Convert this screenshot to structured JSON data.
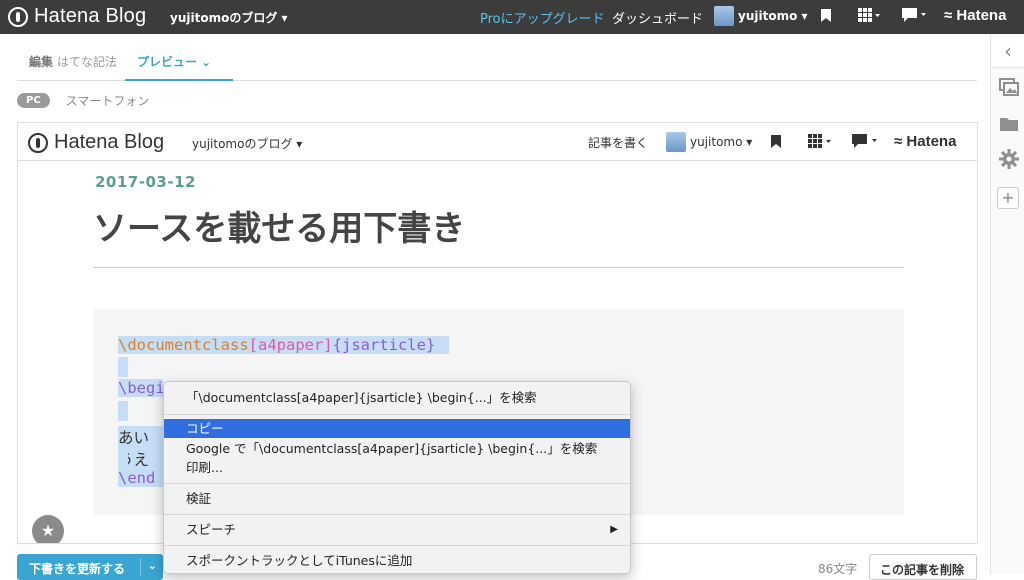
{
  "app": {
    "logo": "Hatena Blog",
    "blog_name": "yujitomoのブログ ▾",
    "pro_upgrade": "Proにアップグレード",
    "dashboard": "ダッシュボード",
    "user": "yujitomo ▾",
    "hatena": "Hatena"
  },
  "tabs": {
    "edit_label": "編集",
    "edit_mode": "はてな記法",
    "preview_label": "プレビュー ⌄"
  },
  "device": {
    "pc": "PC",
    "smartphone": "スマートフォン"
  },
  "preview": {
    "header": {
      "logo": "Hatena Blog",
      "blog_name": "yujitomoのブログ ▾",
      "write": "記事を書く",
      "user": "yujitomo ▾",
      "hatena": "Hatena"
    },
    "date": "2017-03-12",
    "title": "ソースを載せる用下書き",
    "code": {
      "l1_kw": "\\documentclass",
      "l1_opt": "[a4paper]",
      "l1_arg": "{jsarticle}",
      "l2_kw": "\\begi",
      "l3_text": "あいうえ",
      "l4_kw": "\\end"
    }
  },
  "context_menu": {
    "search": "「\\documentclass[a4paper]{jsarticle}  \\begin{...」を検索",
    "copy": "コピー",
    "google_search": "Google で「\\documentclass[a4paper]{jsarticle}  \\begin{...」を検索",
    "print": "印刷...",
    "inspect": "検証",
    "speech": "スピーチ",
    "itunes": "スポークントラックとしてiTunesに追加"
  },
  "footer": {
    "update_button": "下書きを更新する",
    "char_count": "86文字",
    "delete_button": "この記事を削除"
  },
  "colors": {
    "accent": "#39a5d0",
    "topbar": "#3c3c3c",
    "menu_highlight": "#2f6de1",
    "selection": "#c6ddf6"
  }
}
